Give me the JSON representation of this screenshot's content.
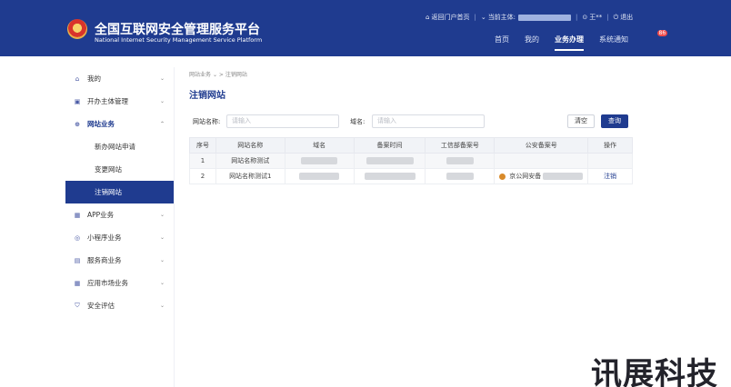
{
  "header": {
    "title": "全国互联网安全管理服务平台",
    "subtitle": "National Internet Security Management Service Platform",
    "top_links": {
      "portal": "返回门户首页",
      "current_subject": "当前主体:",
      "user": "王**",
      "logout": "退出"
    },
    "nav": [
      {
        "label": "首页"
      },
      {
        "label": "我的"
      },
      {
        "label": "业务办理",
        "active": true
      },
      {
        "label": "系统通知",
        "badge": "86"
      }
    ]
  },
  "sidebar": {
    "items": [
      {
        "label": "我的",
        "icon": "home-icon",
        "chevron": "⌄"
      },
      {
        "label": "开办主体管理",
        "icon": "org-icon",
        "chevron": "⌄"
      },
      {
        "label": "网站业务",
        "icon": "globe-icon",
        "chevron": "⌃"
      },
      {
        "label": "APP业务",
        "icon": "grid-icon",
        "chevron": "⌄"
      },
      {
        "label": "小程序业务",
        "icon": "miniprogram-icon",
        "chevron": "⌄"
      },
      {
        "label": "服务商业务",
        "icon": "service-icon",
        "chevron": "⌄"
      },
      {
        "label": "应用市场业务",
        "icon": "grid-icon",
        "chevron": "⌄"
      },
      {
        "label": "安全评估",
        "icon": "shield-icon",
        "chevron": "⌄"
      }
    ],
    "subitems": [
      {
        "label": "新办网站申请"
      },
      {
        "label": "变更网站"
      },
      {
        "label": "注销网站"
      }
    ]
  },
  "breadcrumb": {
    "parent": "网站业务",
    "current": "注销网站"
  },
  "page_title": "注销网站",
  "search": {
    "site_name_label": "网站名称:",
    "site_name_placeholder": "请输入",
    "domain_label": "域名:",
    "domain_placeholder": "请输入",
    "clear_label": "清空",
    "query_label": "查询"
  },
  "table": {
    "headers": [
      "序号",
      "网站名称",
      "域名",
      "备案时间",
      "工信部备案号",
      "公安备案号",
      "操作"
    ],
    "rows": [
      {
        "no": "1",
        "name": "网站名称测试",
        "gongan": "",
        "action": ""
      },
      {
        "no": "2",
        "name": "网站名称测试1",
        "gongan": "京公网安备",
        "action": "注销"
      }
    ]
  },
  "watermark": "讯展科技"
}
